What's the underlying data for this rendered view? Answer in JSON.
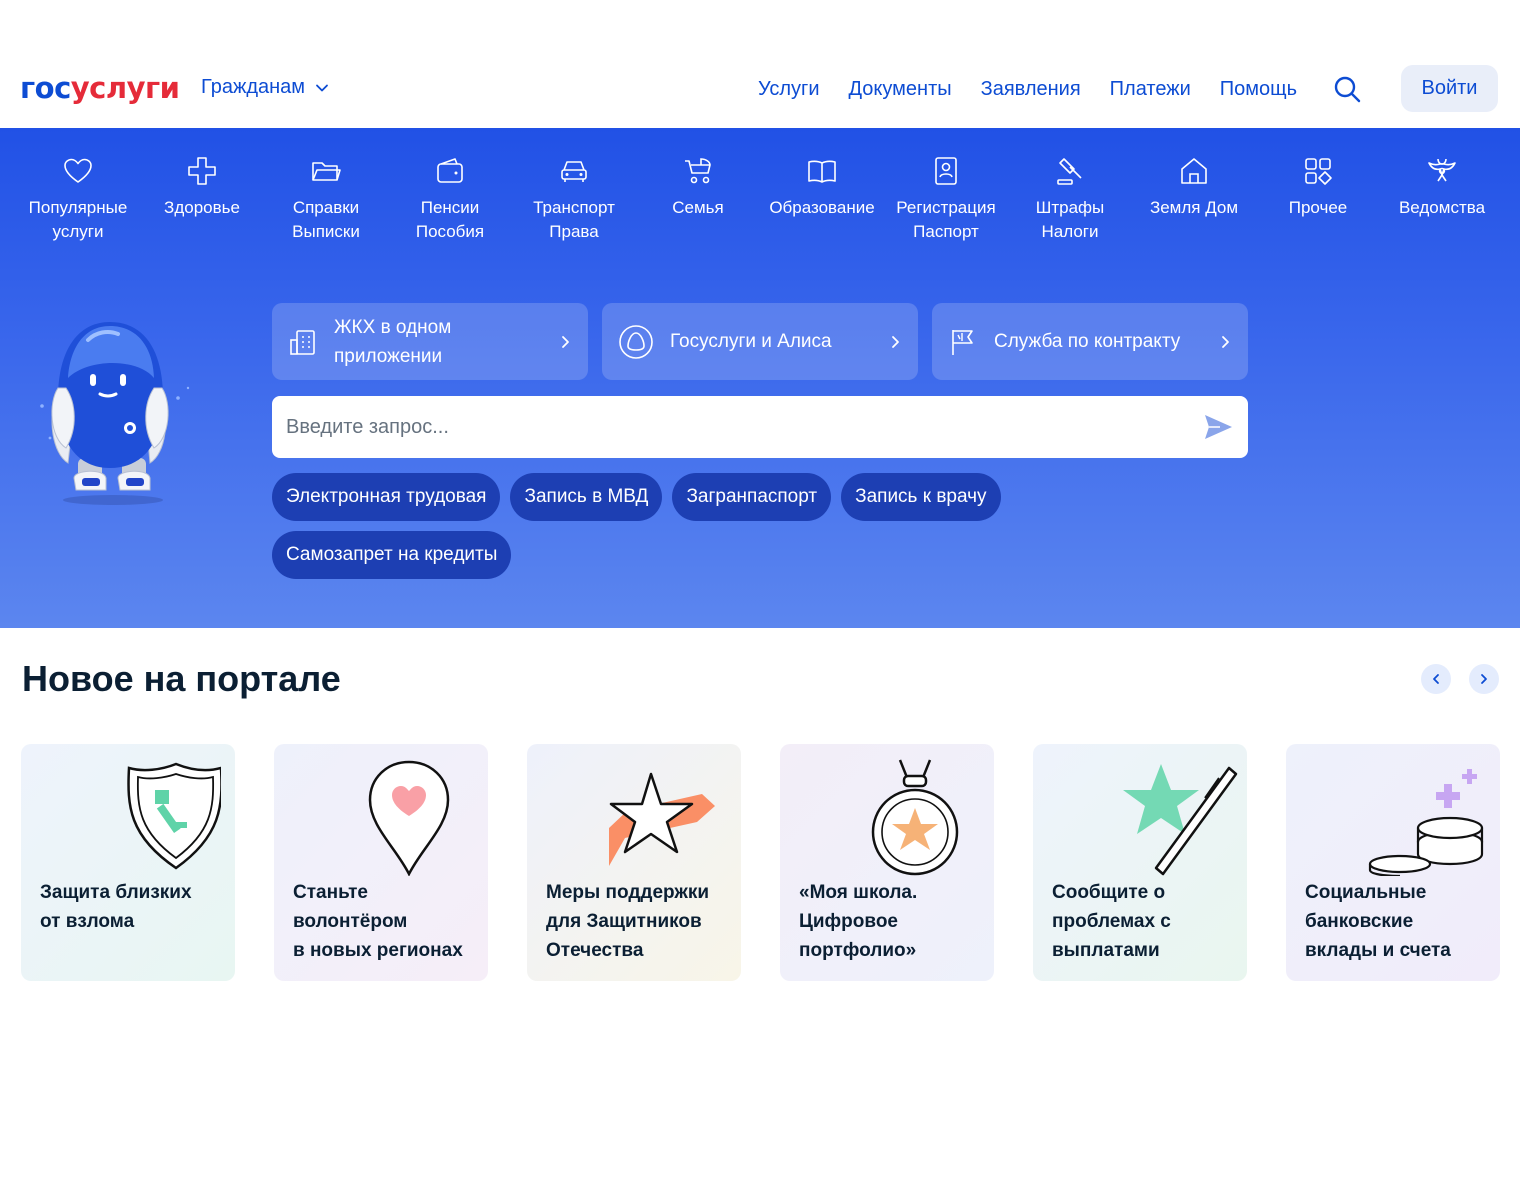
{
  "header": {
    "logo_part1": "гос",
    "logo_part2": "услуги",
    "audience": "Гражданам",
    "nav": [
      "Услуги",
      "Документы",
      "Заявления",
      "Платежи",
      "Помощь"
    ],
    "login": "Войти"
  },
  "categories": [
    {
      "label": "Популярные\nуслуги",
      "icon": "heart-icon"
    },
    {
      "label": "Здоровье",
      "icon": "medical-cross-icon"
    },
    {
      "label": "Справки\nВыписки",
      "icon": "folder-icon"
    },
    {
      "label": "Пенсии\nПособия",
      "icon": "wallet-icon"
    },
    {
      "label": "Транспорт\nПрава",
      "icon": "car-icon"
    },
    {
      "label": "Семья",
      "icon": "stroller-icon"
    },
    {
      "label": "Образование",
      "icon": "book-icon"
    },
    {
      "label": "Регистрация\nПаспорт",
      "icon": "id-card-icon"
    },
    {
      "label": "Штрафы\nНалоги",
      "icon": "gavel-icon"
    },
    {
      "label": "Земля Дом",
      "icon": "house-icon"
    },
    {
      "label": "Прочее",
      "icon": "grid-icon"
    },
    {
      "label": "Ведомства",
      "icon": "eagle-icon"
    }
  ],
  "promos": [
    {
      "label": "ЖКХ в одном приложении",
      "icon": "building-icon"
    },
    {
      "label": "Госуслуги и Алиса",
      "icon": "alice-icon"
    },
    {
      "label": "Служба по контракту",
      "icon": "flag-icon"
    }
  ],
  "search": {
    "placeholder": "Введите запрос..."
  },
  "chips": [
    "Электронная трудовая",
    "Запись в МВД",
    "Загранпаспорт",
    "Запись к врачу",
    "Самозапрет на кредиты"
  ],
  "news": {
    "title": "Новое на портале",
    "cards": [
      "Защита близких\nот взлома",
      "Станьте\nволонтёром\nв новых регионах",
      "Меры поддержки\nдля Защитников\nОтечества",
      "«Моя школа.\nЦифровое\nпортфолио»",
      "Сообщите о\nпроблемах с\nвыплатами",
      "Социальные\nбанковские\nвклады и счета"
    ]
  },
  "colors": {
    "brand_blue": "#0d4cd3",
    "brand_red": "#e52b39",
    "hero_blue": "#2151e6",
    "chip_dark": "#1d3fb3"
  }
}
